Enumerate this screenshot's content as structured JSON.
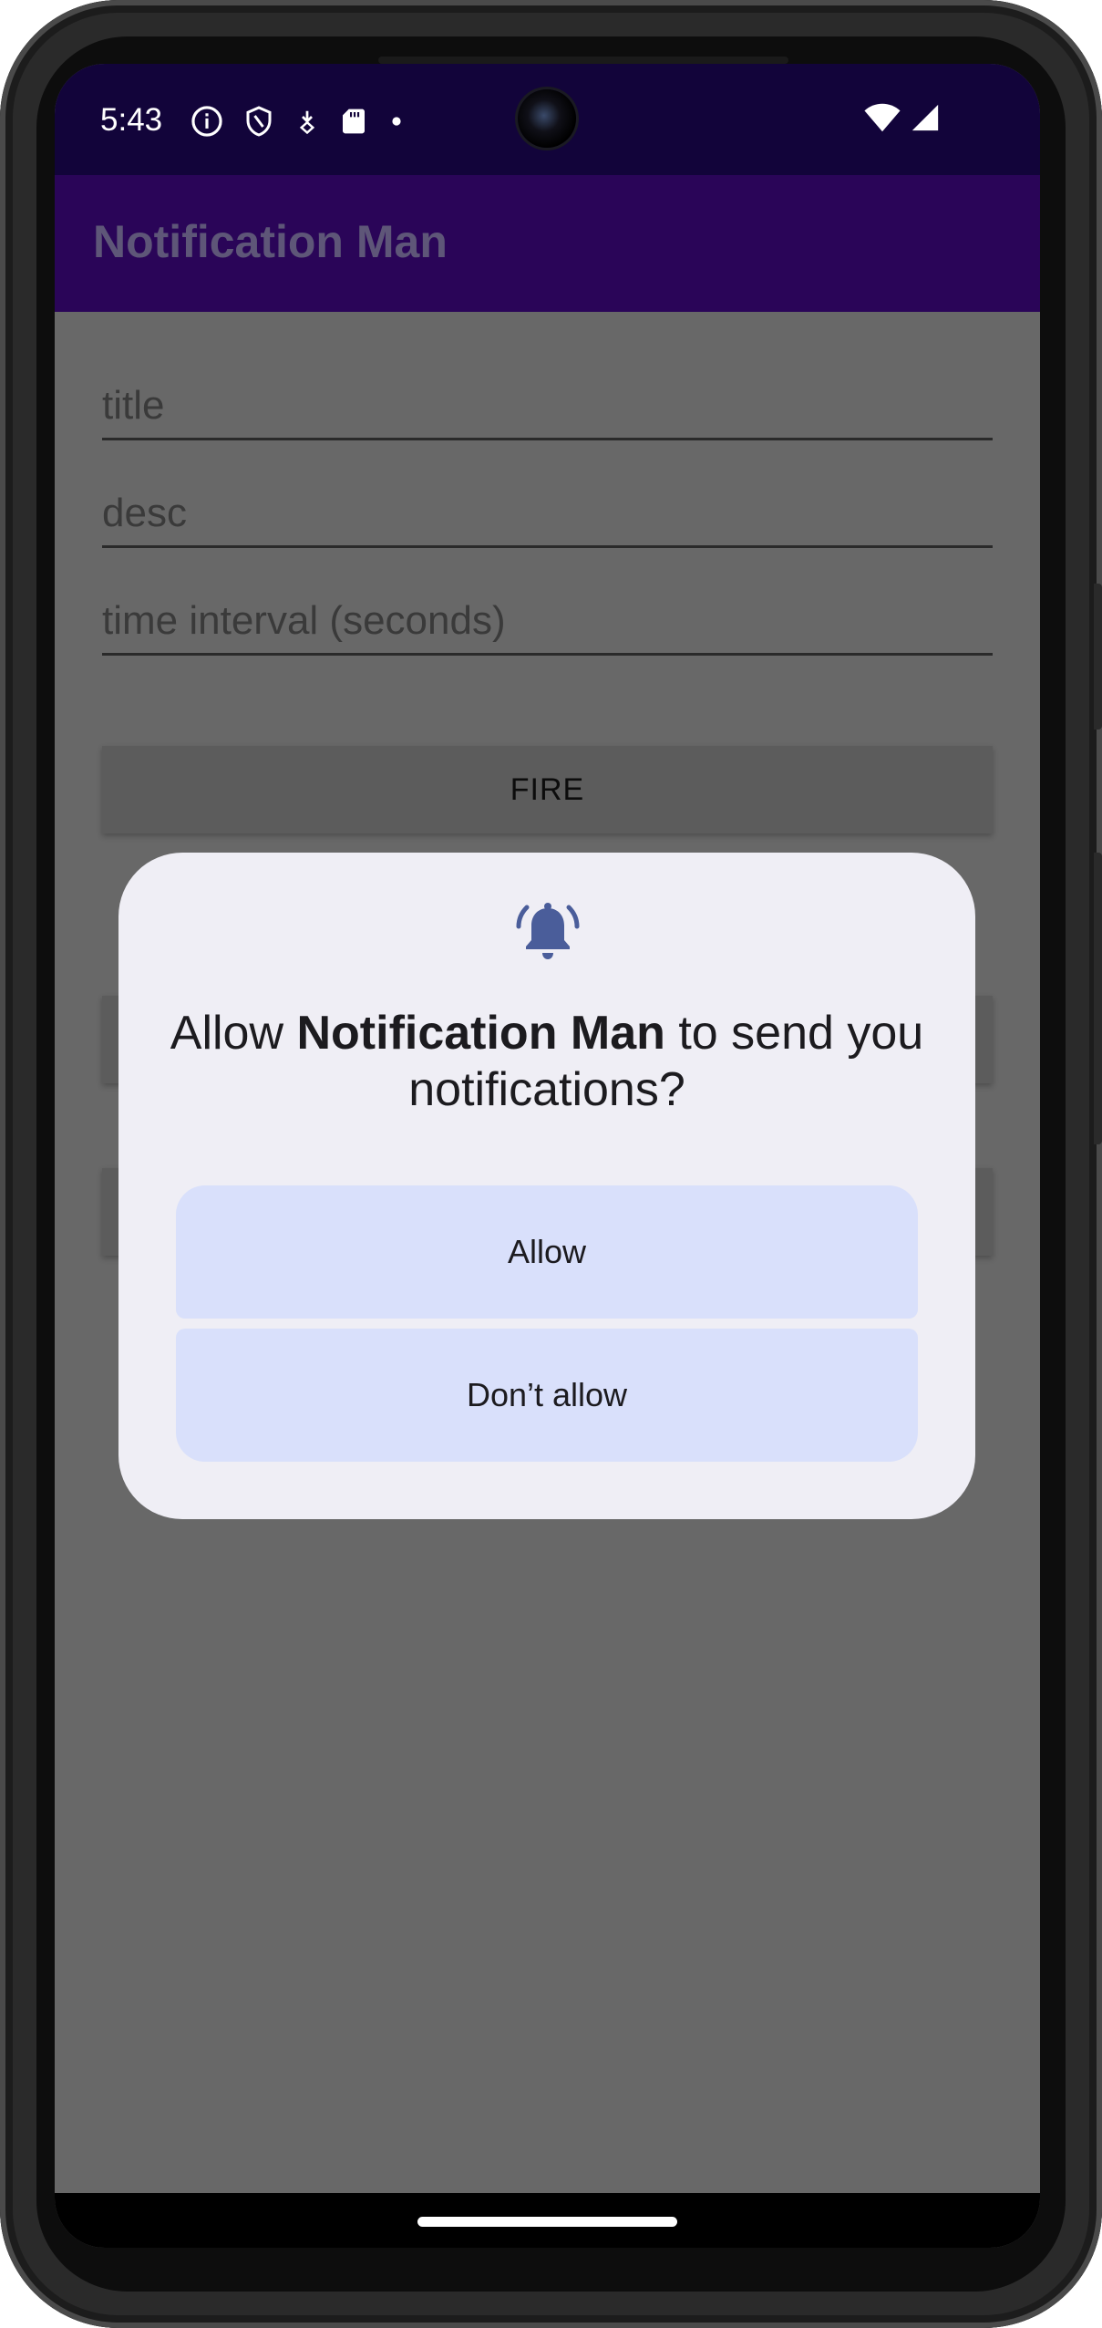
{
  "status_bar": {
    "time": "5:43",
    "icons": [
      "info-icon",
      "shield-icon",
      "download-icon",
      "sd-card-icon",
      "dot-icon"
    ],
    "right_icons": [
      "wifi-icon",
      "signal-icon"
    ]
  },
  "app_bar": {
    "title": "Notification Man"
  },
  "form": {
    "title_placeholder": "title",
    "desc_placeholder": "desc",
    "interval_placeholder": "time interval (seconds)",
    "fire_label": "FIRE"
  },
  "dialog": {
    "icon": "bell-icon",
    "title_prefix": "Allow ",
    "app_name": "Notification Man",
    "title_suffix": " to send you notifications?",
    "allow_label": "Allow",
    "deny_label": "Don’t allow"
  },
  "colors": {
    "status_bar": "#12043a",
    "app_bar": "#2a0558",
    "scrim": "#686868",
    "dialog_bg": "#efeef5",
    "dialog_button": "#d9e0fb",
    "bell_icon": "#4a5d9a"
  }
}
